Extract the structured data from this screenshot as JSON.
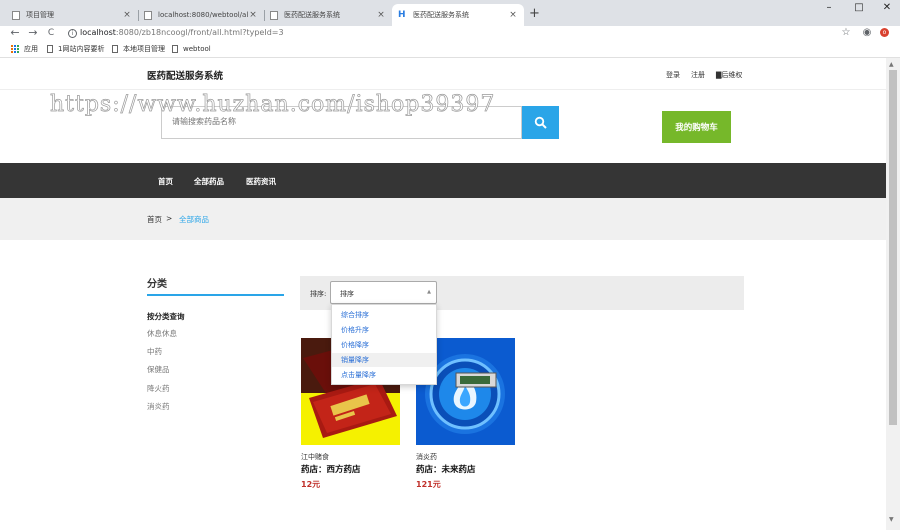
{
  "browser": {
    "tabs": [
      {
        "title": "项目管理",
        "active": false
      },
      {
        "title": "localhost:8080/webtool/all/in",
        "active": false
      },
      {
        "title": "医药配送服务系统",
        "active": false
      },
      {
        "title": "医药配送服务系统",
        "active": true
      }
    ],
    "new_tab": "+",
    "window_controls": {
      "minimize": "–",
      "maximize": "□",
      "close": "✕"
    },
    "nav": {
      "back": "←",
      "forward": "→",
      "reload": "C"
    },
    "url_host": "localhost",
    "url_rest": ":8080/zb18ncoogl/front/all.html?typeId=3",
    "bookmarks": [
      {
        "label": "应用",
        "icon": "apps-grid-icon"
      },
      {
        "label": "1网站内容要析",
        "icon": "page-icon"
      },
      {
        "label": "本地项目管理",
        "icon": "page-icon"
      },
      {
        "label": "webtool",
        "icon": "page-icon"
      }
    ],
    "toolbar_icons": {
      "star": "☆",
      "account": "◉",
      "extension": "o"
    }
  },
  "site": {
    "title": "医药配送服务系统",
    "top_links": [
      "登录",
      "注册",
      "▇后维权"
    ],
    "search": {
      "placeholder": "请输搜索药品名称",
      "button_icon": "search-icon"
    },
    "cart_label": "我的购物车",
    "watermark": "https://www.huzhan.com/ishop39397",
    "main_nav": [
      "首页",
      "全部药品",
      "医药资讯"
    ],
    "breadcrumb": {
      "home": "首页",
      "separator": ">",
      "current": "全部商品"
    }
  },
  "sidebar": {
    "title": "分类",
    "items": [
      {
        "label": "按分类查询",
        "head": true
      },
      {
        "label": "休息休息"
      },
      {
        "label": "中药"
      },
      {
        "label": "保健品"
      },
      {
        "label": "降火药"
      },
      {
        "label": "消炎药"
      }
    ]
  },
  "sort": {
    "label": "排序:",
    "selected": "排序",
    "options": [
      "综合排序",
      "价格升序",
      "价格降序",
      "销量降序",
      "点击量降序"
    ],
    "hovered_index": 3
  },
  "products": [
    {
      "name": "江中赌食",
      "store": "药店：西方药店",
      "price": "12元",
      "image": "red-box-on-yellow"
    },
    {
      "name": "消炎药",
      "store": "药店：未来药店",
      "price": "121元",
      "image": "blue-fire-logo"
    }
  ],
  "colors": {
    "accent": "#2aa5e8",
    "cart": "#76b82a",
    "nav_bg": "#353535",
    "price": "#c0302a",
    "link": "#2a6fd6"
  }
}
